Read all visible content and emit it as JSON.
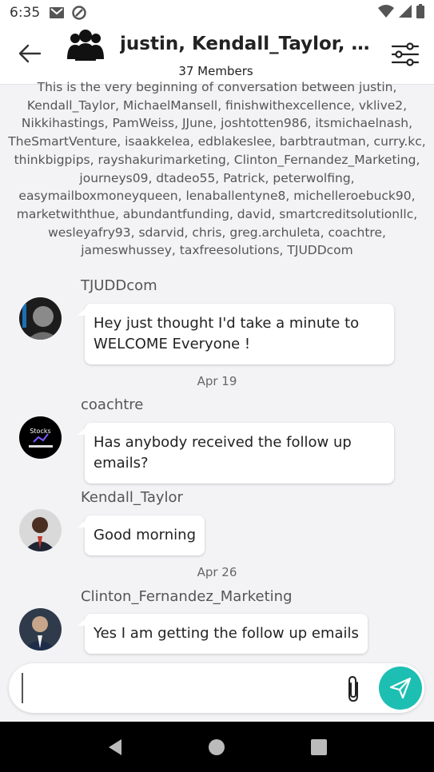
{
  "status_bar": {
    "time": "6:35",
    "icons": [
      "gmail-icon",
      "at-sign-icon",
      "wifi-icon",
      "signal-icon",
      "battery-icon"
    ]
  },
  "header": {
    "title": "justin, Kendall_Taylor, M...",
    "members": "37 Members"
  },
  "intro": {
    "text": "This is the very beginning of conversation between justin, Kendall_Taylor, MichaelMansell, finishwithexcellence, vklive2, Nikkihastings, PamWeiss, JJune, joshtotten986, itsmichaelnash, TheSmartVenture, isaakkelea, edblakeslee, barbtrautman, curry.kc, thinkbigpips, rayshakurimarketing, Clinton_Fernandez_Marketing, journeys09, dtadeo55, Patrick, peterwolfing, easymailboxmoneyqueen, lenaballentyne8, michelleroebuck90, marketwiththue, abundantfunding, david, smartcreditsolutionllc, wesleyafry93, sdarvid, chris, greg.archuleta, coachtre, jameswhussey, taxfreesolutions, TJUDDcom"
  },
  "messages": [
    {
      "sender": "TJUDDcom",
      "text": "Hey just thought I'd take a minute to WELCOME Everyone !"
    },
    {
      "date": "Apr 19"
    },
    {
      "sender": "coachtre",
      "text": "Has anybody received the follow up emails?",
      "avatar_text": "Stocks"
    },
    {
      "sender": "Kendall_Taylor",
      "text": "Good morning"
    },
    {
      "date": "Apr 26"
    },
    {
      "sender": "Clinton_Fernandez_Marketing",
      "text": "Yes I am getting the follow up emails"
    }
  ],
  "composer": {
    "value": "",
    "placeholder": ""
  },
  "colors": {
    "accent": "#1ebfb3",
    "background": "#f3f3f6",
    "bubble": "#ffffff"
  }
}
